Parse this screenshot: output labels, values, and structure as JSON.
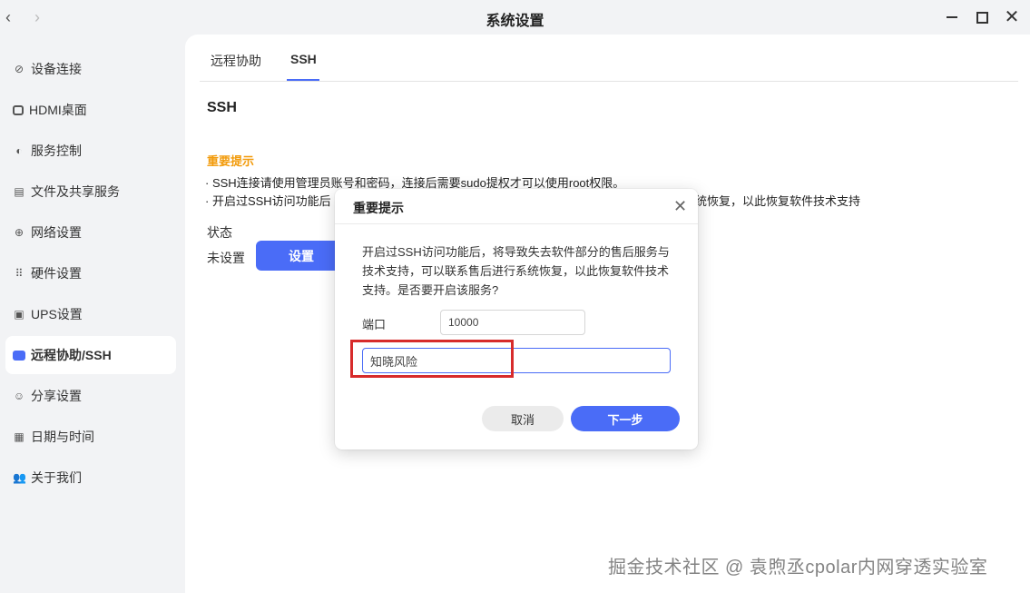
{
  "window": {
    "title": "系统设置",
    "back_icon": "‹",
    "forward_icon": "›",
    "close_icon": "✕"
  },
  "sidebar": {
    "items": [
      {
        "label": "设备连接",
        "icon": "link-icon"
      },
      {
        "label": "HDMI桌面",
        "icon": "monitor-icon"
      },
      {
        "label": "服务控制",
        "icon": "toggle-icon"
      },
      {
        "label": "文件及共享服务",
        "icon": "file-icon"
      },
      {
        "label": "网络设置",
        "icon": "globe-icon"
      },
      {
        "label": "硬件设置",
        "icon": "grid-icon"
      },
      {
        "label": "UPS设置",
        "icon": "battery-icon"
      },
      {
        "label": "远程协助/SSH",
        "icon": "remote-icon",
        "active": true
      },
      {
        "label": "分享设置",
        "icon": "share-icon"
      },
      {
        "label": "日期与时间",
        "icon": "calendar-icon"
      },
      {
        "label": "关于我们",
        "icon": "user-icon"
      }
    ]
  },
  "tabs": [
    {
      "label": "远程协助"
    },
    {
      "label": "SSH",
      "active": true
    }
  ],
  "ssh": {
    "section_title": "SSH",
    "notice_title": "重要提示",
    "notice_line1": "· SSH连接请使用管理员账号和密码，连接后需要sudo提权才可以使用root权限。",
    "notice_line2_head": "· 开启过SSH访问功能后",
    "notice_line2_tail": "统恢复，以此恢复软件技术支持",
    "status_label": "状态",
    "status_value": "未设置",
    "setup_button": "设置"
  },
  "modal": {
    "title": "重要提示",
    "body": "开启过SSH访问功能后，将导致失去软件部分的售后服务与技术支持，可以联系售后进行系统恢复，以此恢复软件技术支持。是否要开启该服务?",
    "port_label": "端口",
    "port_value": "10000",
    "confirm_value": "知晓风险",
    "cancel_button": "取消",
    "next_button": "下一步"
  },
  "watermark": "掘金技术社区 @ 袁煦丞cpolar内网穿透实验室",
  "colors": {
    "accent": "#4a6cf7",
    "notice": "#f29b0b",
    "highlight": "#d72b2b"
  }
}
